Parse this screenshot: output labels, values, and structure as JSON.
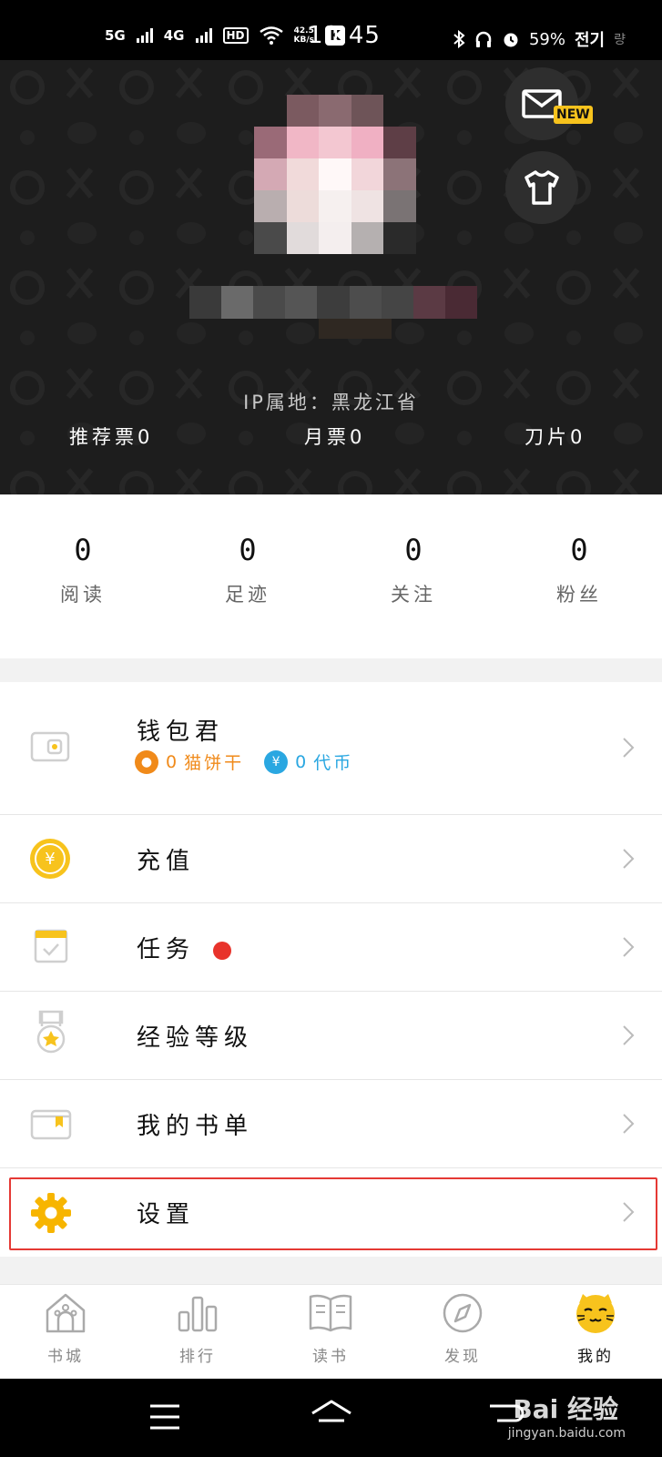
{
  "status_bar": {
    "network_1": "5G",
    "network_2": "4G",
    "hd": "HD",
    "speed_value": "42.5",
    "speed_unit": "KB/s",
    "app_badge": "K",
    "time": "10:45",
    "battery": "59%",
    "battery_label": "전기",
    "extra": "량"
  },
  "header": {
    "ip_location": "IP属地：黑龙江省",
    "tickets": {
      "recommend": "推荐票0",
      "monthly": "月票0",
      "blade": "刀片0"
    },
    "new_badge": "NEW"
  },
  "stats": [
    {
      "value": "0",
      "label": "阅读"
    },
    {
      "value": "0",
      "label": "足迹"
    },
    {
      "value": "0",
      "label": "关注"
    },
    {
      "value": "0",
      "label": "粉丝"
    }
  ],
  "menu": {
    "wallet": {
      "label": "钱包君",
      "cookie_amount": "0",
      "cookie_label": "猫饼干",
      "coin_amount": "0",
      "coin_label": "代币",
      "coin_symbol": "¥"
    },
    "recharge": {
      "label": "充值",
      "symbol": "¥"
    },
    "tasks": {
      "label": "任务"
    },
    "level": {
      "label": "经验等级"
    },
    "booklist": {
      "label": "我的书单"
    },
    "settings": {
      "label": "设置"
    }
  },
  "bottom_nav": [
    {
      "label": "书城",
      "icon": "bookstore-icon"
    },
    {
      "label": "排行",
      "icon": "ranking-icon"
    },
    {
      "label": "读书",
      "icon": "book-icon"
    },
    {
      "label": "发现",
      "icon": "compass-icon"
    },
    {
      "label": "我的",
      "icon": "cat-face-icon"
    }
  ],
  "watermark": {
    "text": "Bai 经验",
    "url": "jingyan.baidu.com"
  },
  "colors": {
    "accent": "#f7c31d",
    "header_bg": "#1d1d1d",
    "highlight": "#e53934",
    "cookie": "#f08a1a",
    "coin": "#2aa7e1"
  }
}
